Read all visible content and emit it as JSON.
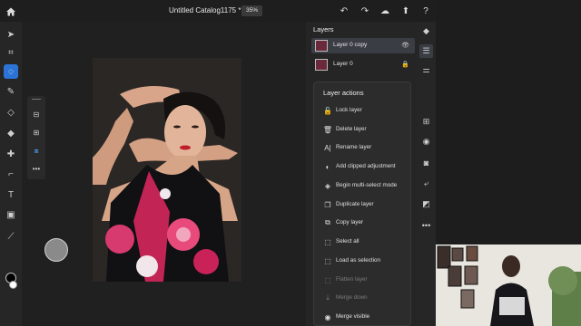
{
  "topbar": {
    "title": "Untitled Catalog1175 *",
    "zoom": "35%",
    "icons": [
      "home-icon",
      "undo-icon",
      "redo-icon",
      "cloud-icon",
      "share-icon",
      "help-icon"
    ]
  },
  "left_tools": [
    "move-tool-icon",
    "transform-tool-icon",
    "lasso-tool-icon",
    "brush-tool-icon",
    "eraser-tool-icon",
    "fill-tool-icon",
    "healing-tool-icon",
    "crop-tool-icon",
    "type-tool-icon",
    "image-tool-icon",
    "eyedropper-tool-icon"
  ],
  "layers_panel": {
    "title": "Layers",
    "layers": [
      {
        "name": "Layer 0 copy",
        "badge": "👁"
      },
      {
        "name": "Layer 0",
        "badge": "🔒"
      }
    ]
  },
  "layer_actions": {
    "title": "Layer actions",
    "items": [
      {
        "label": "Lock layer",
        "icon": "🔓"
      },
      {
        "label": "Delete layer",
        "icon": "🗑"
      },
      {
        "label": "Rename layer",
        "icon": "A|"
      },
      {
        "label": "Add clipped adjustment",
        "icon": "◐"
      },
      {
        "label": "Begin multi-select mode",
        "icon": "◈"
      },
      {
        "label": "Duplicate layer",
        "icon": "❐"
      },
      {
        "label": "Copy layer",
        "icon": "⧉"
      },
      {
        "label": "Select all",
        "icon": "⬚"
      },
      {
        "label": "Load as selection",
        "icon": "⬚"
      },
      {
        "label": "Flatten layer",
        "icon": "⬚"
      },
      {
        "label": "Merge down",
        "icon": "⤓"
      },
      {
        "label": "Merge visible",
        "icon": "◉"
      }
    ]
  },
  "right_tools": [
    "layers-icon",
    "layer-properties-icon",
    "adjustments-icon",
    "add-layer-icon",
    "visibility-icon",
    "mask-icon",
    "clip-icon",
    "fill-opacity-icon",
    "more-icon"
  ]
}
